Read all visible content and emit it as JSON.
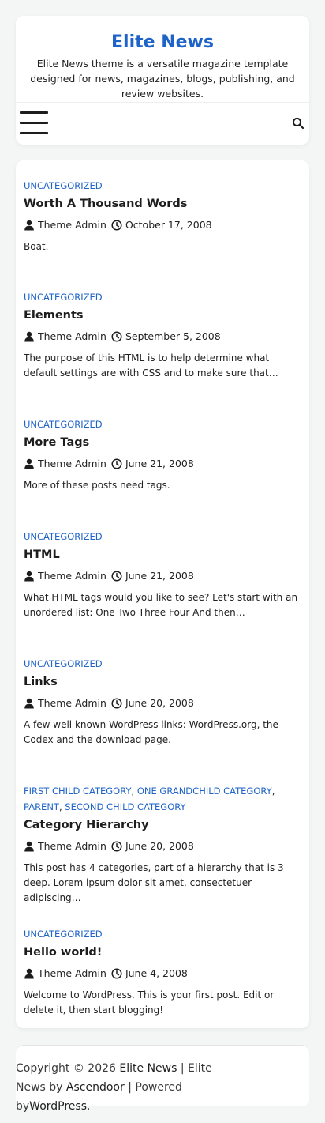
{
  "site": {
    "title": "Elite News",
    "description": "Elite News theme is a versatile magazine template designed for news, magazines, blogs, publishing, and review websites."
  },
  "colors": {
    "accent": "#1e63c8",
    "text": "#1d1d1d",
    "background": "#f4f6f6",
    "card": "#ffffff"
  },
  "nav": {
    "menu_icon": "hamburger-menu-icon",
    "search_icon": "search-icon"
  },
  "posts": [
    {
      "categories": [
        "Uncategorized"
      ],
      "title": "Worth A Thousand Words",
      "author": "Theme Admin",
      "date": "October 17, 2008",
      "excerpt": "Boat."
    },
    {
      "categories": [
        "Uncategorized"
      ],
      "title": "Elements",
      "author": "Theme Admin",
      "date": "September 5, 2008",
      "excerpt": "The purpose of this HTML is to help determine what default settings are with CSS and to make sure that…"
    },
    {
      "categories": [
        "Uncategorized"
      ],
      "title": "More Tags",
      "author": "Theme Admin",
      "date": "June 21, 2008",
      "excerpt": "More of these posts need tags."
    },
    {
      "categories": [
        "Uncategorized"
      ],
      "title": "HTML",
      "author": "Theme Admin",
      "date": "June 21, 2008",
      "excerpt": "What HTML tags would you like to see? Let's start with an unordered list: One Two Three Four And then…"
    },
    {
      "categories": [
        "Uncategorized"
      ],
      "title": "Links",
      "author": "Theme Admin",
      "date": "June 20, 2008",
      "excerpt": "A few well known WordPress links: WordPress.org, the Codex and the download page."
    },
    {
      "categories": [
        "First Child Category",
        "One Grandchild Category",
        "Parent",
        "Second Child Category"
      ],
      "title": "Category Hierarchy",
      "author": "Theme Admin",
      "date": "June 20, 2008",
      "excerpt": "This post has 4 categories, part of a hierarchy that is 3 deep. Lorem ipsum dolor sit amet, consectetuer adipiscing…"
    },
    {
      "categories": [
        "Uncategorized"
      ],
      "title": "Hello world!",
      "author": "Theme Admin",
      "date": "June 4, 2008",
      "excerpt": "Welcome to WordPress. This is your first post. Edit or delete it, then start blogging!"
    }
  ],
  "footer": {
    "copyright": "Copyright © 2026",
    "site_link": "Elite News",
    "sep1": "|",
    "theme_link": "Elite News",
    "by": "by",
    "author_link": "Ascendoor",
    "sep2": "|",
    "powered": "Powered by",
    "wp_link": "WordPress",
    "end": "."
  }
}
